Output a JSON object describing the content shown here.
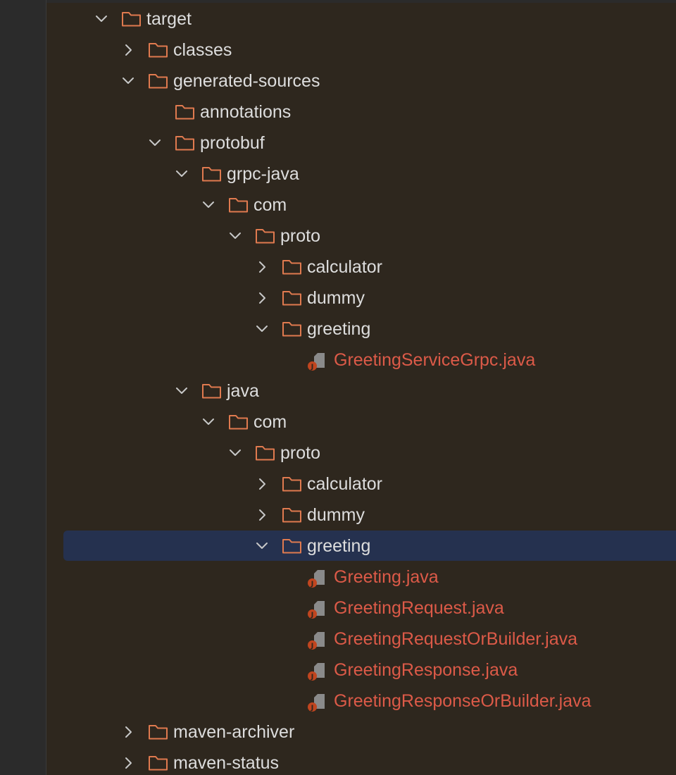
{
  "colors": {
    "folder_stroke": "#e07a4f",
    "java_file_text": "#dc5a48",
    "folder_text": "#dddddd",
    "selection": "#25314f",
    "panel_background": "#2e271e"
  },
  "tree": {
    "target": {
      "label": "target",
      "expanded": true,
      "icon": "folder-icon"
    },
    "classes": {
      "label": "classes",
      "expanded": false,
      "icon": "folder-icon"
    },
    "generated_sources": {
      "label": "generated-sources",
      "expanded": true,
      "icon": "folder-icon"
    },
    "annotations": {
      "label": "annotations",
      "icon": "folder-icon"
    },
    "protobuf": {
      "label": "protobuf",
      "expanded": true,
      "icon": "folder-icon"
    },
    "grpc_java": {
      "label": "grpc-java",
      "expanded": true,
      "icon": "folder-icon"
    },
    "grpc_com": {
      "label": "com",
      "expanded": true,
      "icon": "folder-icon"
    },
    "grpc_proto": {
      "label": "proto",
      "expanded": true,
      "icon": "folder-icon"
    },
    "grpc_calculator": {
      "label": "calculator",
      "expanded": false,
      "icon": "folder-icon"
    },
    "grpc_dummy": {
      "label": "dummy",
      "expanded": false,
      "icon": "folder-icon"
    },
    "grpc_greeting": {
      "label": "greeting",
      "expanded": true,
      "icon": "folder-icon"
    },
    "greeting_service_grpc": {
      "label": "GreetingServiceGrpc.java",
      "icon": "java-file-icon"
    },
    "java": {
      "label": "java",
      "expanded": true,
      "icon": "folder-icon"
    },
    "java_com": {
      "label": "com",
      "expanded": true,
      "icon": "folder-icon"
    },
    "java_proto": {
      "label": "proto",
      "expanded": true,
      "icon": "folder-icon"
    },
    "java_calculator": {
      "label": "calculator",
      "expanded": false,
      "icon": "folder-icon"
    },
    "java_dummy": {
      "label": "dummy",
      "expanded": false,
      "icon": "folder-icon"
    },
    "java_greeting": {
      "label": "greeting",
      "expanded": true,
      "selected": true,
      "icon": "folder-icon"
    },
    "greeting_java": {
      "label": "Greeting.java",
      "icon": "java-file-icon"
    },
    "greeting_request_java": {
      "label": "GreetingRequest.java",
      "icon": "java-file-icon"
    },
    "greeting_request_or_builder_java": {
      "label": "GreetingRequestOrBuilder.java",
      "icon": "java-file-icon"
    },
    "greeting_response_java": {
      "label": "GreetingResponse.java",
      "icon": "java-file-icon"
    },
    "greeting_response_or_builder_java": {
      "label": "GreetingResponseOrBuilder.java",
      "icon": "java-file-icon"
    },
    "maven_archiver": {
      "label": "maven-archiver",
      "expanded": false,
      "icon": "folder-icon"
    },
    "maven_status": {
      "label": "maven-status",
      "expanded": false,
      "icon": "folder-icon"
    }
  }
}
